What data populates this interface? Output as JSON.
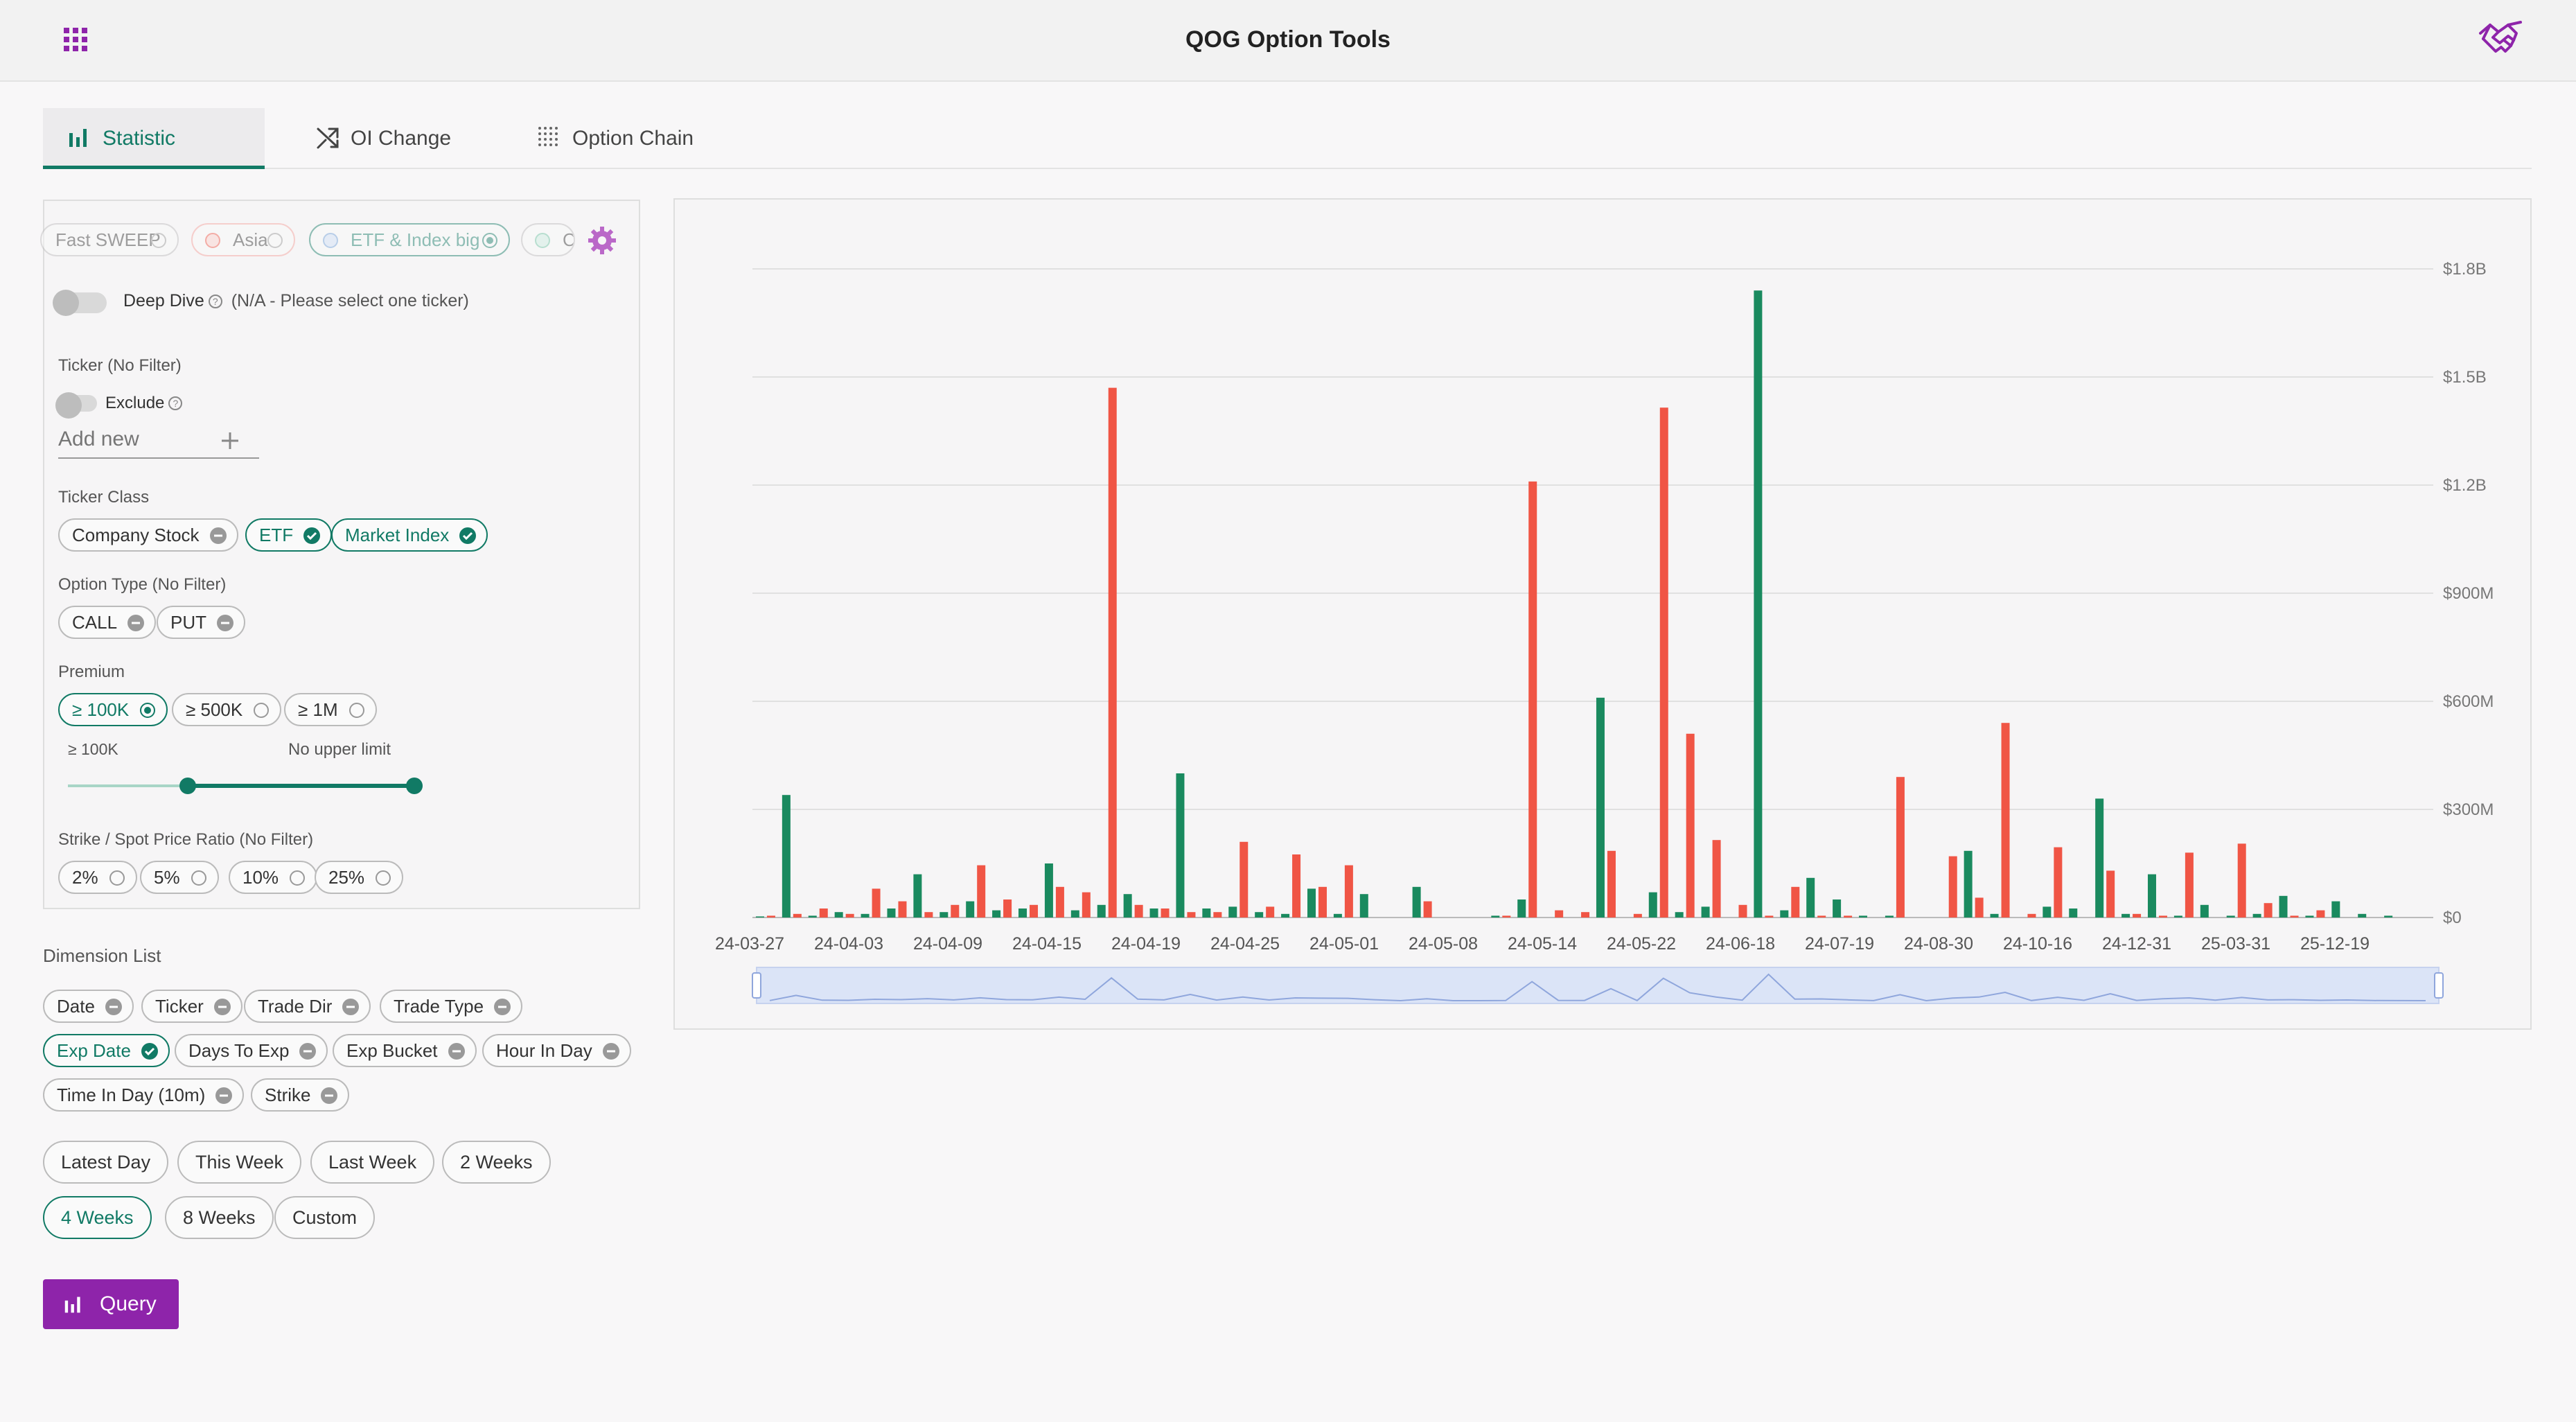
{
  "app": {
    "title": "QOG Option Tools",
    "menu_icon": "apps-grid-icon",
    "logo_icon": "handshake-logo-icon"
  },
  "tabs": [
    {
      "label": "Statistic",
      "icon": "bar-chart-icon",
      "active": true
    },
    {
      "label": "OI Change",
      "icon": "shuffle-icon",
      "active": false
    },
    {
      "label": "Option Chain",
      "icon": "dot-grid-icon",
      "active": false
    }
  ],
  "presets": [
    {
      "label": "Fast SWEEP",
      "selected": false
    },
    {
      "label": "Asia",
      "selected": false
    },
    {
      "label": "ETF & Index big",
      "selected": true
    },
    {
      "label": "C",
      "selected": false
    }
  ],
  "deep_dive": {
    "label": "Deep Dive",
    "note": "(N/A - Please select one ticker)",
    "enabled": false
  },
  "ticker": {
    "label": "Ticker (No Filter)",
    "exclude_label": "Exclude",
    "placeholder": "Add new"
  },
  "ticker_class": {
    "label": "Ticker Class",
    "items": [
      {
        "label": "Company Stock",
        "selected": false
      },
      {
        "label": "ETF",
        "selected": true
      },
      {
        "label": "Market Index",
        "selected": true
      }
    ]
  },
  "option_type": {
    "label": "Option Type (No Filter)",
    "items": [
      {
        "label": "CALL",
        "selected": false
      },
      {
        "label": "PUT",
        "selected": false
      }
    ]
  },
  "premium": {
    "label": "Premium",
    "items": [
      {
        "label": "≥ 100K",
        "selected": true
      },
      {
        "label": "≥ 500K",
        "selected": false
      },
      {
        "label": "≥ 1M",
        "selected": false
      }
    ],
    "range_min_label": "≥ 100K",
    "range_max_label": "No upper limit",
    "range_low_fraction": 0.33,
    "range_high_fraction": 1.0
  },
  "strike_ratio": {
    "label": "Strike / Spot Price Ratio (No Filter)",
    "items": [
      {
        "label": "2%",
        "selected": false
      },
      {
        "label": "5%",
        "selected": false
      },
      {
        "label": "10%",
        "selected": false
      },
      {
        "label": "25%",
        "selected": false
      }
    ]
  },
  "dimensions": {
    "label": "Dimension List",
    "items": [
      {
        "label": "Date",
        "selected": false
      },
      {
        "label": "Ticker",
        "selected": false
      },
      {
        "label": "Trade Dir",
        "selected": false
      },
      {
        "label": "Trade Type",
        "selected": false
      },
      {
        "label": "Exp Date",
        "selected": true
      },
      {
        "label": "Days To Exp",
        "selected": false
      },
      {
        "label": "Exp Bucket",
        "selected": false
      },
      {
        "label": "Hour In Day",
        "selected": false
      },
      {
        "label": "Time In Day (10m)",
        "selected": false
      },
      {
        "label": "Strike",
        "selected": false
      }
    ]
  },
  "periods": [
    {
      "label": "Latest Day",
      "selected": false
    },
    {
      "label": "This Week",
      "selected": false
    },
    {
      "label": "Last Week",
      "selected": false
    },
    {
      "label": "2 Weeks",
      "selected": false
    },
    {
      "label": "4 Weeks",
      "selected": true
    },
    {
      "label": "8 Weeks",
      "selected": false
    },
    {
      "label": "Custom",
      "selected": false
    }
  ],
  "query": {
    "label": "Query",
    "icon": "bar-chart-icon"
  },
  "colors": {
    "accent": "#117a65",
    "brand": "#8e24aa",
    "call": "#1a8a5f",
    "put": "#f05545"
  },
  "chart_data": {
    "type": "bar",
    "yticks": [
      "$0",
      "$300M",
      "$600M",
      "$900M",
      "$1.2B",
      "$1.5B",
      "$1.8B"
    ],
    "ylim": [
      0,
      1800
    ],
    "y_unit": "M",
    "xticks": [
      "24-03-27",
      "24-04-03",
      "24-04-09",
      "24-04-15",
      "24-04-19",
      "24-04-25",
      "24-05-01",
      "24-05-08",
      "24-05-14",
      "24-05-22",
      "24-06-18",
      "24-07-19",
      "24-08-30",
      "24-10-16",
      "24-12-31",
      "25-03-31",
      "25-12-19"
    ],
    "grid": true,
    "zoom_slider": true,
    "series": [
      {
        "values": [
          3,
          340,
          5,
          15,
          10,
          25,
          120,
          15,
          45,
          20,
          25,
          150,
          20,
          35,
          65,
          25,
          400,
          25,
          30,
          15,
          10,
          80,
          10,
          65,
          0,
          85,
          0,
          0,
          5,
          50,
          0,
          0,
          610,
          0,
          70,
          15,
          30,
          0,
          1740,
          20,
          110,
          50,
          5,
          5,
          0,
          0,
          185,
          10,
          0,
          30,
          25,
          330,
          10,
          120,
          5,
          35,
          5,
          10,
          60,
          5,
          45,
          10,
          5,
          0
        ]
      },
      {
        "values": [
          5,
          10,
          25,
          10,
          80,
          45,
          15,
          35,
          145,
          50,
          35,
          85,
          70,
          1470,
          35,
          25,
          15,
          15,
          210,
          30,
          175,
          85,
          145,
          0,
          0,
          45,
          0,
          0,
          5,
          1210,
          20,
          15,
          185,
          10,
          1415,
          510,
          215,
          35,
          5,
          85,
          5,
          5,
          0,
          390,
          0,
          170,
          55,
          540,
          10,
          195,
          0,
          130,
          10,
          5,
          180,
          0,
          205,
          40,
          5,
          20
        ]
      }
    ]
  }
}
